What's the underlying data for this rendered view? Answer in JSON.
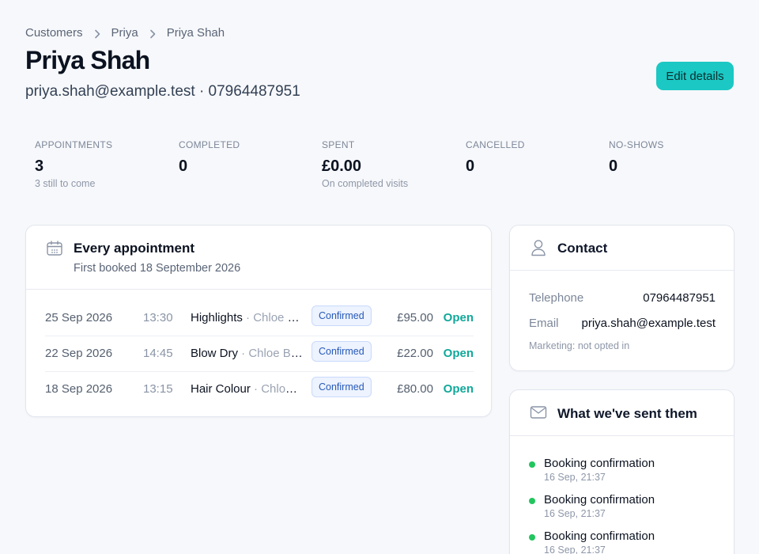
{
  "breadcrumb": [
    "Customers",
    "Priya",
    "Priya Shah"
  ],
  "header": {
    "title": "Priya Shah",
    "subtitle": "priya.shah@example.test · 07964487951",
    "edit_label": "Edit details"
  },
  "stats": [
    {
      "label": "APPOINTMENTS",
      "value": "3",
      "sub": "3 still to come"
    },
    {
      "label": "COMPLETED",
      "value": "0",
      "sub": ""
    },
    {
      "label": "SPENT",
      "value": "£0.00",
      "sub": "On completed visits"
    },
    {
      "label": "CANCELLED",
      "value": "0",
      "sub": ""
    },
    {
      "label": "NO-SHOWS",
      "value": "0",
      "sub": ""
    }
  ],
  "appointments": {
    "title": "Every appointment",
    "subtitle": "First booked 18 September 2026",
    "rows": [
      {
        "date": "25 Sep 2026",
        "time": "13:30",
        "service": "Highlights",
        "staff": " · Chloe Bennett",
        "status": "Confirmed",
        "price": "£95.00",
        "action": "Open"
      },
      {
        "date": "22 Sep 2026",
        "time": "14:45",
        "service": "Blow Dry",
        "staff": " · Chloe Bennett",
        "status": "Confirmed",
        "price": "£22.00",
        "action": "Open"
      },
      {
        "date": "18 Sep 2026",
        "time": "13:15",
        "service": "Hair Colour",
        "staff": " · Chloe Bennett",
        "status": "Confirmed",
        "price": "£80.00",
        "action": "Open"
      }
    ]
  },
  "contact": {
    "title": "Contact",
    "telephone_label": "Telephone",
    "telephone": "07964487951",
    "email_label": "Email",
    "email": "priya.shah@example.test",
    "marketing": "Marketing: not opted in"
  },
  "sent": {
    "title": "What we've sent them",
    "items": [
      {
        "label": "Booking confirmation",
        "when": "16 Sep, 21:37"
      },
      {
        "label": "Booking confirmation",
        "when": "16 Sep, 21:37"
      },
      {
        "label": "Booking confirmation",
        "when": "16 Sep, 21:37"
      }
    ]
  },
  "colors": {
    "accent": "#1bc8c4",
    "open_link": "#11a89a",
    "badge_text": "#2759b8",
    "sent_dot": "#22c55e"
  }
}
